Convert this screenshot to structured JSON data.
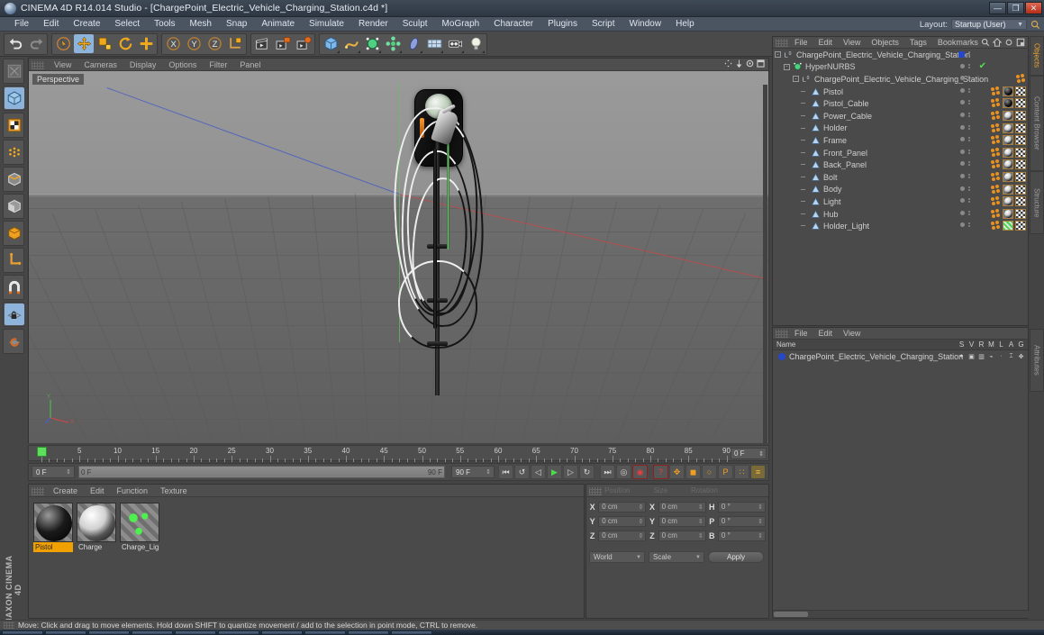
{
  "window": {
    "title": "CINEMA 4D R14.014 Studio - [ChargePoint_Electric_Vehicle_Charging_Station.c4d *]",
    "app_icon": "cinema4d-logo-icon",
    "minimize_label": "—",
    "maximize_label": "❐",
    "close_label": "✕",
    "brand": "MAXON CINEMA 4D"
  },
  "menubar": {
    "items": [
      {
        "label": "File"
      },
      {
        "label": "Edit"
      },
      {
        "label": "Create"
      },
      {
        "label": "Select"
      },
      {
        "label": "Tools"
      },
      {
        "label": "Mesh"
      },
      {
        "label": "Snap"
      },
      {
        "label": "Animate"
      },
      {
        "label": "Simulate"
      },
      {
        "label": "Render"
      },
      {
        "label": "Sculpt"
      },
      {
        "label": "MoGraph"
      },
      {
        "label": "Character"
      },
      {
        "label": "Plugins"
      },
      {
        "label": "Script"
      },
      {
        "label": "Window"
      },
      {
        "label": "Help"
      }
    ],
    "layout_label": "Layout:",
    "layout_value": "Startup (User)",
    "search_icon": "magnifier-icon"
  },
  "toolbar": {
    "groups": [
      {
        "name": "history",
        "buttons": [
          {
            "name": "undo-button",
            "icon": "undo-arrow-icon",
            "active": false
          },
          {
            "name": "redo-button",
            "icon": "redo-arrow-icon",
            "active": false
          }
        ]
      },
      {
        "name": "tools",
        "buttons": [
          {
            "name": "live-selection-tool",
            "icon": "cursor-circle-icon",
            "active": false
          },
          {
            "name": "move-tool",
            "icon": "move-cross-icon",
            "active": true
          },
          {
            "name": "scale-tool",
            "icon": "scale-box-icon",
            "active": false
          },
          {
            "name": "rotate-tool",
            "icon": "rotate-circle-icon",
            "active": false
          },
          {
            "name": "add-tool",
            "icon": "plus-cross-icon",
            "active": false
          }
        ]
      },
      {
        "name": "axis-locks",
        "buttons": [
          {
            "name": "lock-x-axis",
            "icon": "x-axis-icon",
            "active": false
          },
          {
            "name": "lock-y-axis",
            "icon": "y-axis-icon",
            "active": false
          },
          {
            "name": "lock-z-axis",
            "icon": "z-axis-icon",
            "active": false
          },
          {
            "name": "world-object-coordinates",
            "icon": "coordinate-system-icon",
            "active": false
          }
        ]
      },
      {
        "name": "render",
        "buttons": [
          {
            "name": "render-view-button",
            "icon": "render-clapper-icon",
            "active": false
          },
          {
            "name": "render-to-picture-viewer-button",
            "icon": "render-picture-icon",
            "active": false
          },
          {
            "name": "render-settings-button",
            "icon": "render-settings-icon",
            "active": false
          }
        ]
      },
      {
        "name": "objects",
        "buttons": [
          {
            "name": "add-cube-object",
            "icon": "cube-icon",
            "active": false
          },
          {
            "name": "add-spline-object",
            "icon": "spline-icon",
            "active": false
          },
          {
            "name": "add-nurbs-object",
            "icon": "nurbs-icon",
            "active": false
          },
          {
            "name": "add-mograph-object",
            "icon": "mograph-icon",
            "active": false
          },
          {
            "name": "add-deformer-object",
            "icon": "deformer-icon",
            "active": false
          },
          {
            "name": "add-floor-environment",
            "icon": "floor-icon",
            "active": false
          },
          {
            "name": "add-camera",
            "icon": "camera-icon",
            "active": false
          },
          {
            "name": "add-light",
            "icon": "light-bulb-icon",
            "active": false
          }
        ]
      }
    ]
  },
  "left_toolbar": {
    "buttons": [
      {
        "name": "make-editable-button",
        "icon": "make-editable-icon",
        "active": false
      },
      {
        "name": "model-mode-button",
        "icon": "model-cube-icon",
        "active": true
      },
      {
        "name": "texture-mode-button",
        "icon": "texture-checker-icon",
        "active": false
      },
      {
        "name": "points-mode-button",
        "icon": "points-grid-icon",
        "active": false
      },
      {
        "name": "edges-mode-button",
        "icon": "edges-cube-icon",
        "active": false
      },
      {
        "name": "polygons-mode-button",
        "icon": "polygons-cube-icon",
        "active": false
      },
      {
        "name": "object-axis-mode-button",
        "icon": "orange-cube-icon",
        "active": false
      },
      {
        "name": "axis-modification-button",
        "icon": "axis-l-icon",
        "active": false
      },
      {
        "name": "enable-snapping-button",
        "icon": "magnet-icon",
        "active": false
      },
      {
        "name": "lock-workplane-button",
        "icon": "workplane-lock-icon",
        "active": true
      },
      {
        "name": "workplane-rotate-button",
        "icon": "workplane-rotate-icon",
        "active": false
      }
    ]
  },
  "viewport": {
    "menu": [
      {
        "label": "View"
      },
      {
        "label": "Cameras"
      },
      {
        "label": "Display"
      },
      {
        "label": "Options"
      },
      {
        "label": "Filter"
      },
      {
        "label": "Panel"
      }
    ],
    "view_label": "Perspective",
    "nav_icons": [
      {
        "name": "pan-view-icon"
      },
      {
        "name": "zoom-view-icon"
      },
      {
        "name": "rotate-view-icon"
      },
      {
        "name": "maximize-view-icon"
      }
    ],
    "axis_labels": {
      "x": "X",
      "y": "Y",
      "z": "Z"
    },
    "scene_object": "EV charging station on pole with coiled charging cables"
  },
  "timeline": {
    "ticks": [
      0,
      5,
      10,
      15,
      20,
      25,
      30,
      35,
      40,
      45,
      50,
      55,
      60,
      65,
      70,
      75,
      80,
      85,
      90
    ],
    "end_field": "0 F",
    "current_frame": "0 F",
    "scrub_start": "0 F",
    "scrub_end": "90 F",
    "preview_end": "90 F",
    "controls": [
      {
        "name": "go-to-start-button",
        "icon": "skip-back-icon",
        "glyph": "⏮"
      },
      {
        "name": "play-backwards-button",
        "icon": "loop-back-icon",
        "glyph": "↺"
      },
      {
        "name": "previous-frame-button",
        "icon": "step-back-icon",
        "glyph": "◁"
      },
      {
        "name": "play-forwards-button",
        "icon": "play-icon",
        "glyph": "▶"
      },
      {
        "name": "next-frame-button",
        "icon": "step-forward-icon",
        "glyph": "▷"
      },
      {
        "name": "play-loop-button",
        "icon": "loop-icon",
        "glyph": "↻"
      },
      {
        "name": "go-to-end-button",
        "icon": "skip-forward-icon",
        "glyph": "⏭"
      },
      {
        "name": "autokeying-button",
        "icon": "autokey-icon",
        "glyph": "◎"
      },
      {
        "name": "record-active-objects-button",
        "icon": "record-red-icon",
        "glyph": "◉"
      },
      {
        "name": "keyframe-selection-button",
        "icon": "keyframe-help-icon",
        "glyph": "?"
      },
      {
        "name": "position-key-button",
        "icon": "position-cross-icon",
        "glyph": "✥"
      },
      {
        "name": "scale-key-button",
        "icon": "scale-key-icon",
        "glyph": "◼"
      },
      {
        "name": "rotation-key-button",
        "icon": "rotation-key-icon",
        "glyph": "○"
      },
      {
        "name": "parameter-key-button",
        "icon": "parameter-p-icon",
        "glyph": "P"
      },
      {
        "name": "point-level-animation-button",
        "icon": "pla-dots-icon",
        "glyph": "∷"
      },
      {
        "name": "keyframe-selection-toggle",
        "icon": "key-selection-icon",
        "glyph": "≡"
      }
    ]
  },
  "material_manager": {
    "menu": [
      {
        "label": "Create"
      },
      {
        "label": "Edit"
      },
      {
        "label": "Function"
      },
      {
        "label": "Texture"
      }
    ],
    "materials": [
      {
        "name": "Pistol",
        "selected": true,
        "swatch": "black-glossy-sphere",
        "color": "#0d0d0d"
      },
      {
        "name": "Charge",
        "selected": false,
        "swatch": "white-black-sphere",
        "color": "#e8e8e8"
      },
      {
        "name": "Charge_Lig",
        "selected": false,
        "swatch": "green-luminance-pattern",
        "color": "#3ddc3d"
      }
    ]
  },
  "coordinates": {
    "headers": [
      "Position",
      "Size",
      "Rotation"
    ],
    "rows": [
      {
        "pos_label": "X",
        "pos_value": "0 cm",
        "size_label": "X",
        "size_value": "0 cm",
        "rot_label": "H",
        "rot_value": "0 °"
      },
      {
        "pos_label": "Y",
        "pos_value": "0 cm",
        "size_label": "Y",
        "size_value": "0 cm",
        "rot_label": "P",
        "rot_value": "0 °"
      },
      {
        "pos_label": "Z",
        "pos_value": "0 cm",
        "size_label": "Z",
        "size_value": "0 cm",
        "rot_label": "B",
        "rot_value": "0 °"
      }
    ],
    "system_select": "World",
    "mode_select": "Scale",
    "apply_label": "Apply"
  },
  "object_manager": {
    "menu": [
      {
        "label": "File"
      },
      {
        "label": "Edit"
      },
      {
        "label": "View"
      },
      {
        "label": "Objects"
      },
      {
        "label": "Tags"
      },
      {
        "label": "Bookmarks"
      }
    ],
    "header_icons": [
      {
        "name": "om-search-icon"
      },
      {
        "name": "om-home-icon"
      },
      {
        "name": "om-minimize-icon"
      },
      {
        "name": "om-expand-icon"
      }
    ],
    "objects": [
      {
        "label": "ChargePoint_Electric_Vehicle_Charging_Station",
        "depth": 0,
        "icon": "null-object-icon",
        "layer_color": "#2648c8",
        "has_material": false,
        "has_uv": false,
        "checkmark": false
      },
      {
        "label": "HyperNURBS",
        "depth": 1,
        "icon": "hypernurbs-icon",
        "layer_color": "",
        "has_material": false,
        "has_uv": false,
        "checkmark": true
      },
      {
        "label": "ChargePoint_Electric_Vehicle_Charging_Station",
        "depth": 2,
        "icon": "null-object-icon",
        "layer_color": "",
        "has_material": false,
        "has_uv": false,
        "checkmark": false
      },
      {
        "label": "Pistol",
        "depth": 3,
        "icon": "polygon-object-icon",
        "layer_color": "",
        "has_material": true,
        "has_uv": true,
        "material_color": "#111111",
        "checkmark": false
      },
      {
        "label": "Pistol_Cable",
        "depth": 3,
        "icon": "polygon-object-icon",
        "layer_color": "",
        "has_material": true,
        "has_uv": true,
        "material_color": "#111111",
        "checkmark": false
      },
      {
        "label": "Power_Cable",
        "depth": 3,
        "icon": "polygon-object-icon",
        "layer_color": "",
        "has_material": true,
        "has_uv": true,
        "material_color": "#dddddd",
        "checkmark": false
      },
      {
        "label": "Holder",
        "depth": 3,
        "icon": "polygon-object-icon",
        "layer_color": "",
        "has_material": true,
        "has_uv": true,
        "material_color": "#dddddd",
        "checkmark": false
      },
      {
        "label": "Frame",
        "depth": 3,
        "icon": "polygon-object-icon",
        "layer_color": "",
        "has_material": true,
        "has_uv": true,
        "material_color": "#dddddd",
        "checkmark": false
      },
      {
        "label": "Front_Panel",
        "depth": 3,
        "icon": "polygon-object-icon",
        "layer_color": "",
        "has_material": true,
        "has_uv": true,
        "material_color": "#dddddd",
        "checkmark": false
      },
      {
        "label": "Back_Panel",
        "depth": 3,
        "icon": "polygon-object-icon",
        "layer_color": "",
        "has_material": true,
        "has_uv": true,
        "material_color": "#dddddd",
        "checkmark": false
      },
      {
        "label": "Bolt",
        "depth": 3,
        "icon": "polygon-object-icon",
        "layer_color": "",
        "has_material": true,
        "has_uv": true,
        "material_color": "#dddddd",
        "checkmark": false
      },
      {
        "label": "Body",
        "depth": 3,
        "icon": "polygon-object-icon",
        "layer_color": "",
        "has_material": true,
        "has_uv": true,
        "material_color": "#dddddd",
        "checkmark": false
      },
      {
        "label": "Light",
        "depth": 3,
        "icon": "polygon-object-icon",
        "layer_color": "",
        "has_material": true,
        "has_uv": true,
        "material_color": "#dddddd",
        "checkmark": false
      },
      {
        "label": "Hub",
        "depth": 3,
        "icon": "polygon-object-icon",
        "layer_color": "",
        "has_material": true,
        "has_uv": true,
        "material_color": "#dddddd",
        "checkmark": false
      },
      {
        "label": "Holder_Light",
        "depth": 3,
        "icon": "polygon-object-icon",
        "layer_color": "",
        "has_material": true,
        "has_uv": true,
        "material_color": "#6dc46d",
        "checkmark": false
      }
    ]
  },
  "layer_manager": {
    "menu": [
      {
        "label": "File"
      },
      {
        "label": "Edit"
      },
      {
        "label": "View"
      }
    ],
    "name_column": "Name",
    "columns": [
      "S",
      "V",
      "R",
      "M",
      "L",
      "A",
      "G"
    ],
    "rows": [
      {
        "label": "ChargePoint_Electric_Vehicle_Charging_Station",
        "color": "#2648c8"
      }
    ]
  },
  "side_tabs": [
    {
      "label": "Objects",
      "active": true
    },
    {
      "label": "Content Browser",
      "active": false
    },
    {
      "label": "Structure",
      "active": false
    }
  ],
  "side_tab_bottom": {
    "label": "Attributes"
  },
  "statusbar": {
    "text": "Move: Click and drag to move elements. Hold down SHIFT to quantize movement / add to the selection in point mode, CTRL to remove."
  },
  "taskbar": {
    "items": [
      {
        "name": "taskbar-item-1"
      },
      {
        "name": "taskbar-item-2"
      },
      {
        "name": "taskbar-item-3"
      },
      {
        "name": "taskbar-item-4"
      },
      {
        "name": "taskbar-item-5"
      },
      {
        "name": "taskbar-item-6"
      },
      {
        "name": "taskbar-item-7"
      },
      {
        "name": "taskbar-item-8"
      },
      {
        "name": "taskbar-item-9"
      },
      {
        "name": "taskbar-item-10"
      }
    ]
  }
}
